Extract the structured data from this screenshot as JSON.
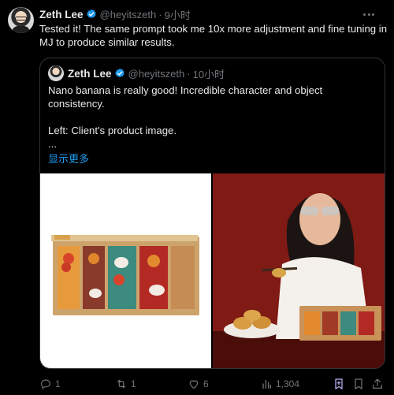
{
  "tweet": {
    "author_name": "Zeth Lee",
    "author_handle": "@heyitszeth",
    "separator": "·",
    "time": "9小时",
    "text": "Tested it! The same prompt took me 10x more adjustment and fine tuning in MJ to produce similar results."
  },
  "quoted_tweet": {
    "author_name": "Zeth Lee",
    "author_handle": "@heyitszeth",
    "separator": "·",
    "time": "10小时",
    "lines": [
      "Nano banana is really good! Incredible character and object consistency.",
      "",
      "Left: Client's product image.",
      "..."
    ],
    "show_more": "显示更多"
  },
  "actions": {
    "replies": "1",
    "reposts": "1",
    "likes": "6",
    "views": "1,304"
  },
  "colors": {
    "background": "#000000",
    "text": "#e7e9ea",
    "muted": "#71767b",
    "accent": "#1d9bf0",
    "bookmark_active": "#c4b5fd"
  },
  "icons": [
    "verified-badge-icon",
    "more-dots-icon",
    "reply-icon",
    "repost-icon",
    "like-icon",
    "views-icon",
    "bookmark-icon",
    "share-icon"
  ]
}
